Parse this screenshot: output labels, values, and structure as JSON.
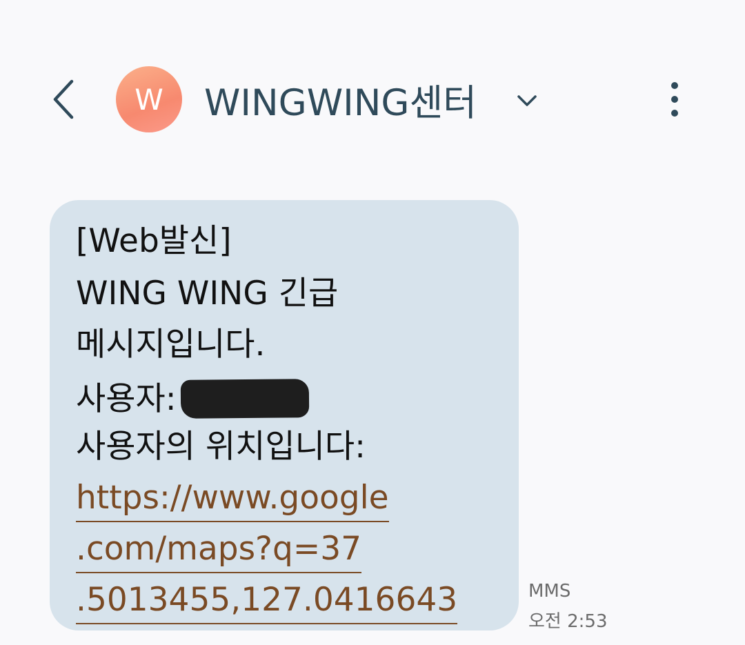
{
  "header": {
    "back_icon": "chevron-left-icon",
    "avatar_letter": "W",
    "avatar_colors": [
      "#fbb08a",
      "#f7896f"
    ],
    "contact_name": "WINGWING센터",
    "expand_icon": "chevron-down-icon",
    "more_icon": "more-vertical-icon"
  },
  "message": {
    "line1": "[Web발신]",
    "line2": "WING WING 긴급",
    "line3": "메시지입니다.",
    "line4_label": "사용자:",
    "line4_redacted": true,
    "line5": "사용자의 위치입니다:",
    "link_lines": [
      "https://www.google",
      ".com/maps?q=37",
      ".5013455,127.0416643"
    ],
    "bubble_color": "#d7e3ec",
    "link_color": "#7a4a24"
  },
  "meta": {
    "type": "MMS",
    "time": "오전 2:53"
  }
}
